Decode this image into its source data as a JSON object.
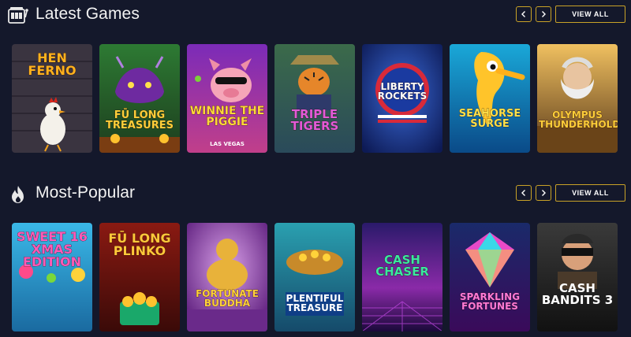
{
  "sections": [
    {
      "title": "Latest Games",
      "icon": "slot-machine-icon",
      "view_all_label": "VIEW ALL",
      "games": [
        {
          "title": "HEN FERNO"
        },
        {
          "title": "FŪ LONG TREASURES"
        },
        {
          "title": "WINNIE the Piggie",
          "subtitle": "LAS VEGAS"
        },
        {
          "title": "TRIPLE TIGERS"
        },
        {
          "title": "LIBERTY ROCKETS"
        },
        {
          "title": "SEAHORSE Surge"
        },
        {
          "title": "OLYMPUS THUNDERHOLD"
        }
      ]
    },
    {
      "title": "Most-Popular",
      "icon": "flame-icon",
      "view_all_label": "VIEW ALL",
      "games": [
        {
          "title": "SWEET 16 XMAS EDITION"
        },
        {
          "title": "FŪ LONG PLINKO"
        },
        {
          "title": "FORTUNATE BUDDHA"
        },
        {
          "title": "PLENTIFUL TREASURE"
        },
        {
          "title": "Cash CHASER"
        },
        {
          "title": "SPARKLING FORTUNES"
        },
        {
          "title": "CASH BANDITS 3"
        }
      ]
    }
  ],
  "colors": {
    "background": "#14182b",
    "accent_border": "#c9a227"
  }
}
